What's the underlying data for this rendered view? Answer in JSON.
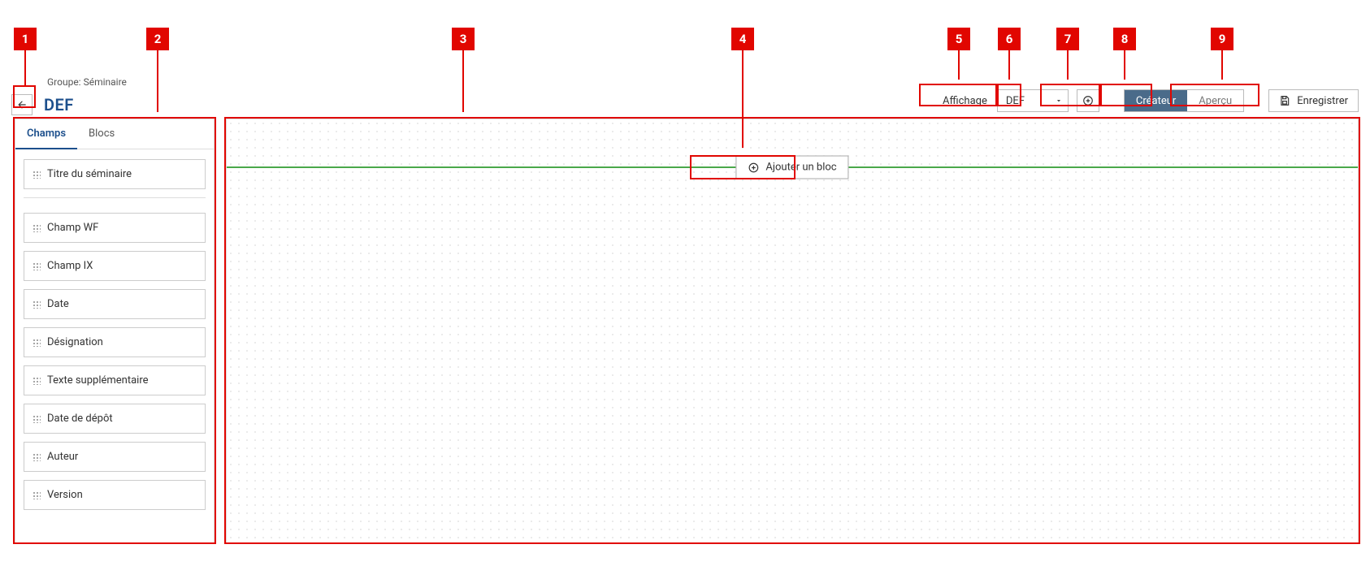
{
  "header": {
    "group_prefix": "Groupe:",
    "group_name": "Séminaire",
    "title": "DEF",
    "affichage_label": "Affichage",
    "affichage_value": "DEF",
    "createur_label": "Créateur",
    "apercu_label": "Aperçu",
    "enregistrer_label": "Enregistrer"
  },
  "sidebar": {
    "tabs": {
      "champs": "Champs",
      "blocs": "Blocs"
    },
    "fields_top": [
      "Titre du séminaire"
    ],
    "fields_rest": [
      "Champ WF",
      "Champ IX",
      "Date",
      "Désignation",
      "Texte supplémentaire",
      "Date de dépôt",
      "Auteur",
      "Version"
    ]
  },
  "canvas": {
    "add_block_label": "Ajouter un bloc"
  },
  "callouts": [
    "1",
    "2",
    "3",
    "4",
    "5",
    "6",
    "7",
    "8",
    "9"
  ]
}
